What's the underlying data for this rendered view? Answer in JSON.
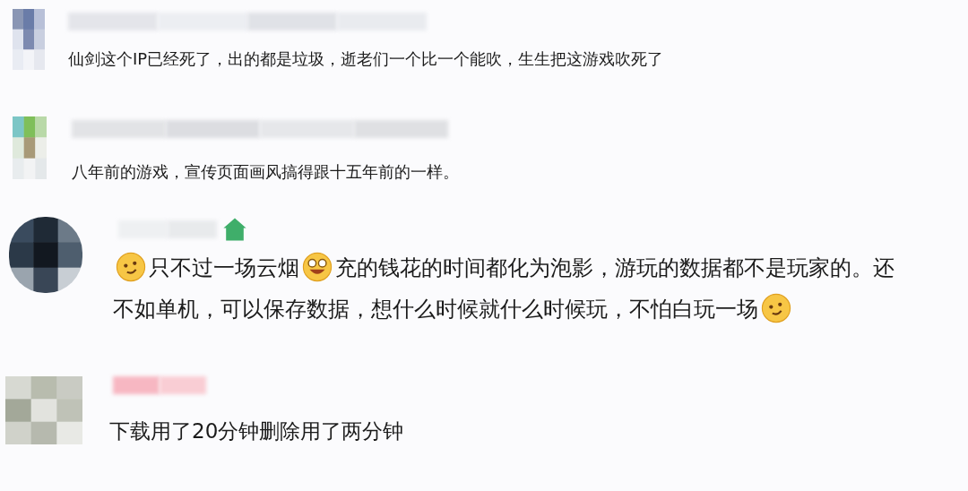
{
  "comments": [
    {
      "badge": false,
      "segments": [
        {
          "kind": "text",
          "text": "仙剑这个IP已经死了，出的都是垃圾，逝老们一个比一个能吹，生生把这游戏吹死了"
        }
      ]
    },
    {
      "badge": false,
      "segments": [
        {
          "kind": "text",
          "text": "八年前的游戏，宣传页面画风搞得跟十五年前的一样。"
        }
      ]
    },
    {
      "badge": true,
      "segments": [
        {
          "kind": "smirk"
        },
        {
          "kind": "text",
          "text": "只不过一场云烟"
        },
        {
          "kind": "grin"
        },
        {
          "kind": "text",
          "text": "充的钱花的时间都化为泡影，游玩的数据都不是玩家的。还"
        },
        {
          "kind": "text",
          "text": "不如单机，可以保存数据，想什么时候就什么时候玩，不怕白玩一场"
        },
        {
          "kind": "smirk"
        }
      ]
    },
    {
      "badge": false,
      "segments": [
        {
          "kind": "text",
          "text": "下载用了20分钟删除用了两分钟"
        }
      ]
    }
  ]
}
